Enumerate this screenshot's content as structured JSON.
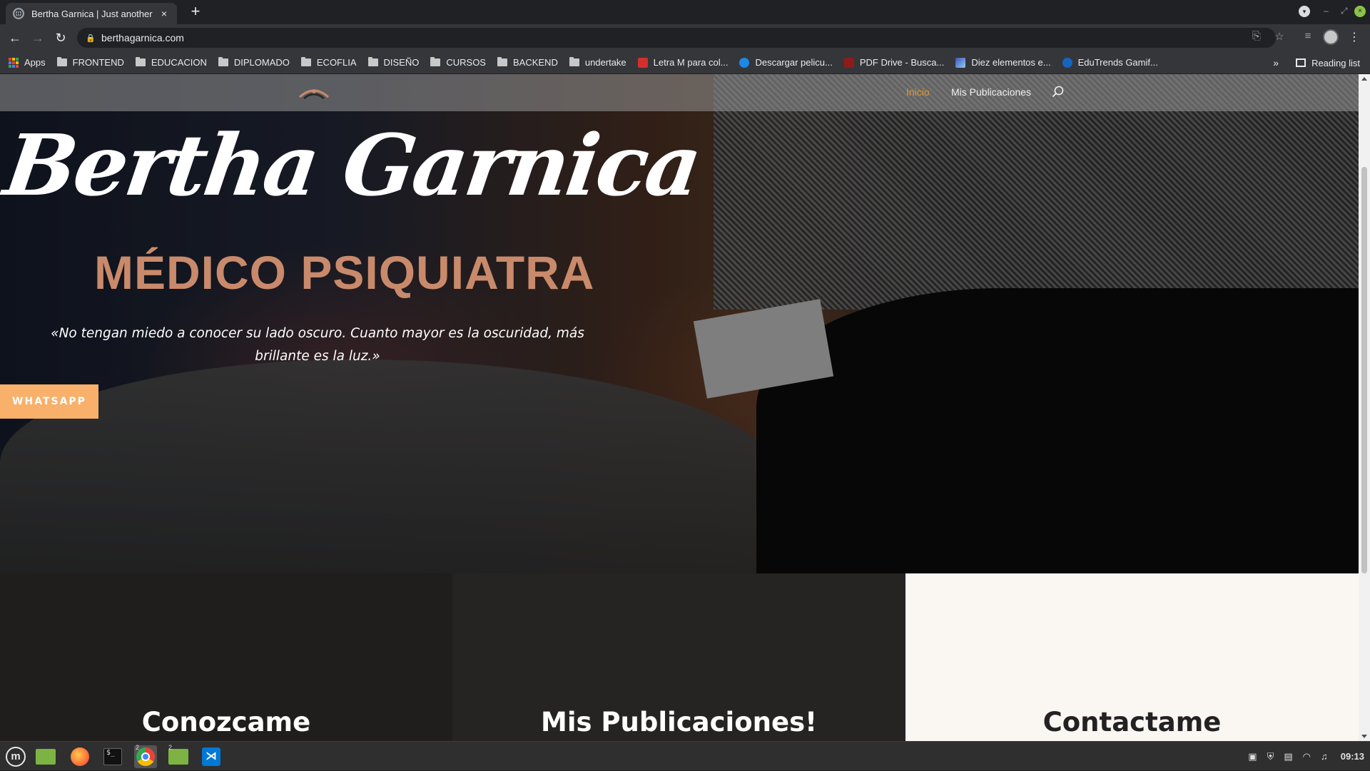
{
  "browser": {
    "tab_title": "Bertha Garnica | Just another",
    "tab_close": "×",
    "new_tab": "+",
    "url": "berthagarnica.com",
    "bookmarks": [
      {
        "label": "Apps",
        "icon": "apps-grid-icon"
      },
      {
        "label": "FRONTEND",
        "icon": "folder-icon"
      },
      {
        "label": "EDUCACION",
        "icon": "folder-icon"
      },
      {
        "label": "DIPLOMADO",
        "icon": "folder-icon"
      },
      {
        "label": "ECOFLIA",
        "icon": "folder-icon"
      },
      {
        "label": "DISEÑO",
        "icon": "folder-icon"
      },
      {
        "label": "CURSOS",
        "icon": "folder-icon"
      },
      {
        "label": "BACKEND",
        "icon": "folder-icon"
      },
      {
        "label": "undertake",
        "icon": "folder-icon"
      },
      {
        "label": "Letra M para col...",
        "icon": "site-favicon-red"
      },
      {
        "label": "Descargar pelicu...",
        "icon": "site-favicon-blue"
      },
      {
        "label": "PDF Drive - Busca...",
        "icon": "site-favicon-pdf"
      },
      {
        "label": "Diez elementos e...",
        "icon": "site-favicon-mountain"
      },
      {
        "label": "EduTrends Gamif...",
        "icon": "site-favicon-globe"
      }
    ],
    "more_bookmarks": "»",
    "reading_list": "Reading list"
  },
  "site": {
    "nav": {
      "inicio": "Inicio",
      "publicaciones": "Mis Publicaciones"
    },
    "hero": {
      "name": "Bertha Garnica",
      "subtitle": "MÉDICO PSIQUIATRA",
      "quote": "«No tengan miedo a conocer su lado oscuro. Cuanto mayor es la oscuridad, más brillante es la luz.»",
      "button": "WHATSAPP"
    },
    "cards": [
      {
        "title": "Conozcame"
      },
      {
        "title": "Mis Publicaciones!"
      },
      {
        "title": "Contactame"
      }
    ]
  },
  "taskbar": {
    "clock": "09:13",
    "terminal_prompt": "$_",
    "badge_chrome": "2",
    "badge_files": "2"
  },
  "colors": {
    "accent_orange": "#e09a3a",
    "button_peach": "#f8b06a",
    "subtitle_copper": "#c98a6b"
  }
}
